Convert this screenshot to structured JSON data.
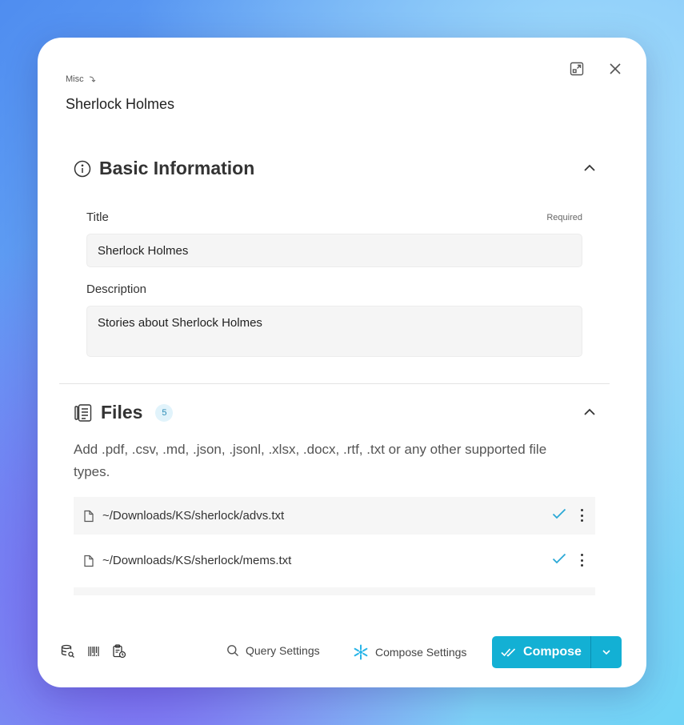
{
  "breadcrumb": "Misc",
  "page_title": "Sherlock Holmes",
  "basic_info": {
    "heading": "Basic Information",
    "title_label": "Title",
    "required_label": "Required",
    "title_value": "Sherlock Holmes",
    "description_label": "Description",
    "description_value": "Stories about Sherlock Holmes"
  },
  "files": {
    "heading": "Files",
    "count": "5",
    "description": "Add .pdf, .csv, .md, .json, .jsonl, .xlsx, .docx, .rtf, .txt or any other supported file types.",
    "items": [
      {
        "path": "~/Downloads/KS/sherlock/advs.txt"
      },
      {
        "path": "~/Downloads/KS/sherlock/mems.txt"
      }
    ]
  },
  "footer": {
    "query_settings": "Query Settings",
    "compose_settings": "Compose Settings",
    "compose": "Compose"
  },
  "colors": {
    "accent": "#13b0d4",
    "check": "#2aa8d6",
    "snowflake": "#29b5e8"
  }
}
